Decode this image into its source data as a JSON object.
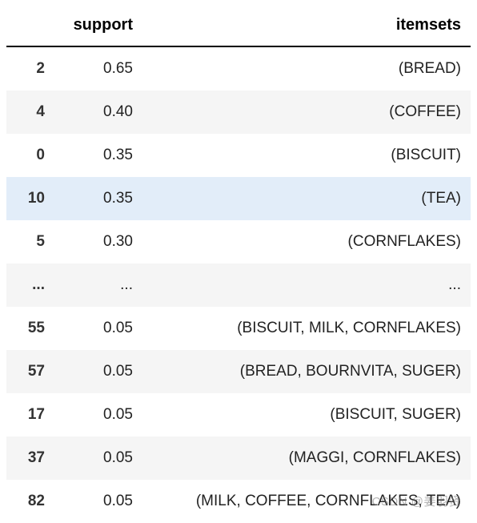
{
  "chart_data": {
    "type": "table",
    "columns": [
      "",
      "support",
      "itemsets"
    ],
    "rows": [
      {
        "index": "2",
        "support": "0.65",
        "itemsets": "(BREAD)",
        "cls": "odd"
      },
      {
        "index": "4",
        "support": "0.40",
        "itemsets": "(COFFEE)",
        "cls": "even"
      },
      {
        "index": "0",
        "support": "0.35",
        "itemsets": "(BISCUIT)",
        "cls": "odd"
      },
      {
        "index": "10",
        "support": "0.35",
        "itemsets": "(TEA)",
        "cls": "highlight"
      },
      {
        "index": "5",
        "support": "0.30",
        "itemsets": "(CORNFLAKES)",
        "cls": "odd"
      },
      {
        "index": "...",
        "support": "...",
        "itemsets": "...",
        "cls": "even"
      },
      {
        "index": "55",
        "support": "0.05",
        "itemsets": "(BISCUIT, MILK, CORNFLAKES)",
        "cls": "odd"
      },
      {
        "index": "57",
        "support": "0.05",
        "itemsets": "(BREAD, BOURNVITA, SUGER)",
        "cls": "even"
      },
      {
        "index": "17",
        "support": "0.05",
        "itemsets": "(BISCUIT, SUGER)",
        "cls": "odd"
      },
      {
        "index": "37",
        "support": "0.05",
        "itemsets": "(MAGGI, CORNFLAKES)",
        "cls": "even"
      },
      {
        "index": "82",
        "support": "0.05",
        "itemsets": "(MILK, COFFEE, CORNFLAKES, TEA)",
        "cls": "odd"
      }
    ]
  },
  "watermark": "CSDN @姜羽贤"
}
